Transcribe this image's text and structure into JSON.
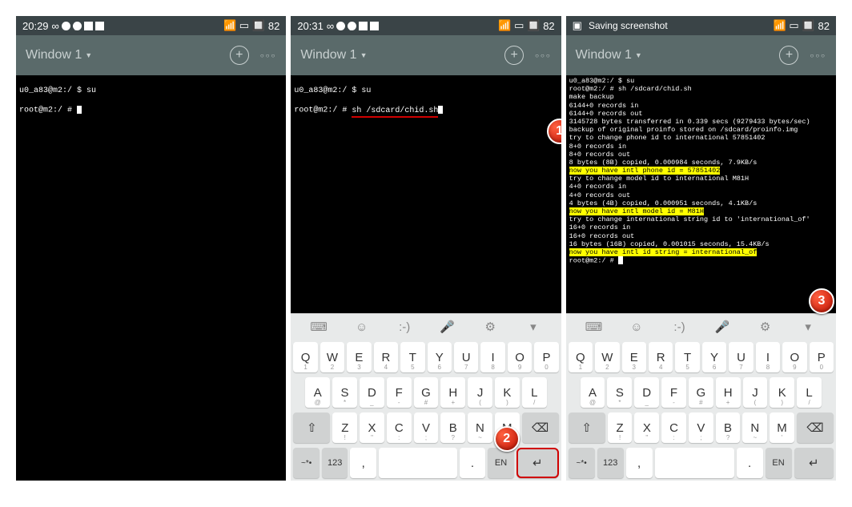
{
  "phones": [
    {
      "time": "20:29",
      "battery": "82",
      "window_title": "Window 1",
      "terminal_lines": [
        {
          "prefix": "u0_a83@m2:/ $ ",
          "cmd": "su"
        },
        {
          "prefix": "root@m2:/ # ",
          "cmd": ""
        }
      ]
    },
    {
      "time": "20:31",
      "battery": "82",
      "window_title": "Window 1",
      "terminal_lines": [
        {
          "prefix": "u0_a83@m2:/ $ ",
          "cmd": "su"
        },
        {
          "prefix": "root@m2:/ # ",
          "cmd": "sh /sdcard/chid.sh",
          "underline": true
        }
      ]
    },
    {
      "saving": "Saving screenshot",
      "battery": "82",
      "window_title": "Window 1",
      "terminal_lines": [
        {
          "t": "u0_a83@m2:/ $ su"
        },
        {
          "t": "root@m2:/ # sh /sdcard/chid.sh"
        },
        {
          "t": "make backup"
        },
        {
          "t": "6144+0 records in"
        },
        {
          "t": "6144+0 records out"
        },
        {
          "t": "3145728 bytes transferred in 0.339 secs (9279433 bytes/sec)"
        },
        {
          "t": "backup of original proinfo stored on /sdcard/proinfo.img"
        },
        {
          "t": "try to change phone id to international 57851402"
        },
        {
          "t": "8+0 records in"
        },
        {
          "t": "8+0 records out"
        },
        {
          "t": "8 bytes (8B) copied, 0.000984 seconds, 7.9KB/s"
        },
        {
          "t": "now you have intl phone id = 57851402",
          "hl": true
        },
        {
          "t": "try to change model id to international M81H"
        },
        {
          "t": "4+0 records in"
        },
        {
          "t": "4+0 records out"
        },
        {
          "t": "4 bytes (4B) copied, 0.000951 seconds, 4.1KB/s"
        },
        {
          "t": "now you have intl model id = M81H",
          "hl": true
        },
        {
          "t": "try to change international string id to 'international_of'"
        },
        {
          "t": "16+0 records in"
        },
        {
          "t": "16+0 records out"
        },
        {
          "t": "16 bytes (16B) copied, 0.001015 seconds, 15.4KB/s"
        },
        {
          "t": "now you have intl id string = international_of",
          "hl": true
        },
        {
          "t": "root@m2:/ # "
        }
      ]
    }
  ],
  "keyboard": {
    "row1": [
      "Q",
      "W",
      "E",
      "R",
      "T",
      "Y",
      "U",
      "I",
      "O",
      "P"
    ],
    "row1_sub": [
      "1",
      "2",
      "3",
      "4",
      "5",
      "6",
      "7",
      "8",
      "9",
      "0"
    ],
    "row2": [
      "A",
      "S",
      "D",
      "F",
      "G",
      "H",
      "J",
      "K",
      "L"
    ],
    "row2_sub": [
      "@",
      "*",
      "_",
      "-",
      "#",
      "+",
      "(",
      ")",
      "/"
    ],
    "row3": [
      "Z",
      "X",
      "C",
      "V",
      "B",
      "N",
      "M"
    ],
    "row3_sub": [
      "!",
      "\"",
      ":",
      ";",
      "?",
      "~",
      "'"
    ],
    "shift": "⇧",
    "backspace": "⌫",
    "sym": "~*•",
    "num": "123",
    "comma": ",",
    "period": ".",
    "lang": "EN",
    "enter": "↵"
  },
  "kb_tools": [
    "⌨",
    "☺",
    ":-)",
    "🎤",
    "⚙",
    "▾"
  ],
  "badges": {
    "b1": "1",
    "b2": "2",
    "b3": "3"
  }
}
